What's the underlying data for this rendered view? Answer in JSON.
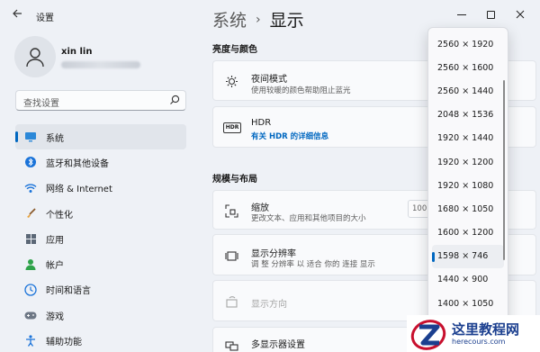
{
  "window": {
    "title": "设置",
    "back_icon": "back-arrow-icon",
    "controls": [
      "minimize-icon",
      "maximize-icon",
      "close-icon"
    ]
  },
  "user": {
    "name": "xin lin"
  },
  "search": {
    "placeholder": "查找设置"
  },
  "nav": {
    "items": [
      {
        "label": "系统",
        "icon": "monitor-icon",
        "active": true
      },
      {
        "label": "蓝牙和其他设备",
        "icon": "bluetooth-icon"
      },
      {
        "label": "网络 & Internet",
        "icon": "wifi-icon"
      },
      {
        "label": "个性化",
        "icon": "brush-icon"
      },
      {
        "label": "应用",
        "icon": "apps-icon"
      },
      {
        "label": "帐户",
        "icon": "account-icon"
      },
      {
        "label": "时间和语言",
        "icon": "globe-clock-icon"
      },
      {
        "label": "游戏",
        "icon": "gamepad-icon"
      },
      {
        "label": "辅助功能",
        "icon": "accessibility-icon"
      }
    ]
  },
  "main": {
    "breadcrumb_parent": "系统",
    "breadcrumb_current": "显示",
    "section_brightness": "亮度与颜色",
    "section_layout": "规模与布局",
    "night_light": {
      "title": "夜间模式",
      "subtitle": "使用较暖的颜色帮助阻止蓝光"
    },
    "hdr": {
      "title": "HDR",
      "link": "有关 HDR 的详细信息",
      "icon_text": "HDR"
    },
    "scale": {
      "title": "缩放",
      "subtitle": "更改文本、应用和其他项目的大小",
      "value": "100"
    },
    "resolution": {
      "title": "显示分辨率",
      "subtitle": "调 整 分辨率 以 适合 你的 连接 显示"
    },
    "orientation": {
      "title": "显示方向"
    },
    "multi_display": {
      "title": "多显示器设置"
    }
  },
  "resolution_dropdown": {
    "options": [
      "2560 × 1920",
      "2560 × 1600",
      "2560 × 1440",
      "2048 × 1536",
      "1920 × 1440",
      "1920 × 1200",
      "1920 × 1080",
      "1680 × 1050",
      "1600 × 1200",
      "1598 × 746",
      "1440 × 900",
      "1400 × 1050"
    ],
    "selected": "1598 × 746"
  },
  "watermark": {
    "title": "这里教程网",
    "url": "herecours.com",
    "brand_color": "#1b3f8f",
    "accent_color": "#c8102e"
  },
  "colors": {
    "accent": "#0067c0",
    "window_bg": "#eef1f6",
    "card_bg": "#f9fafc"
  }
}
